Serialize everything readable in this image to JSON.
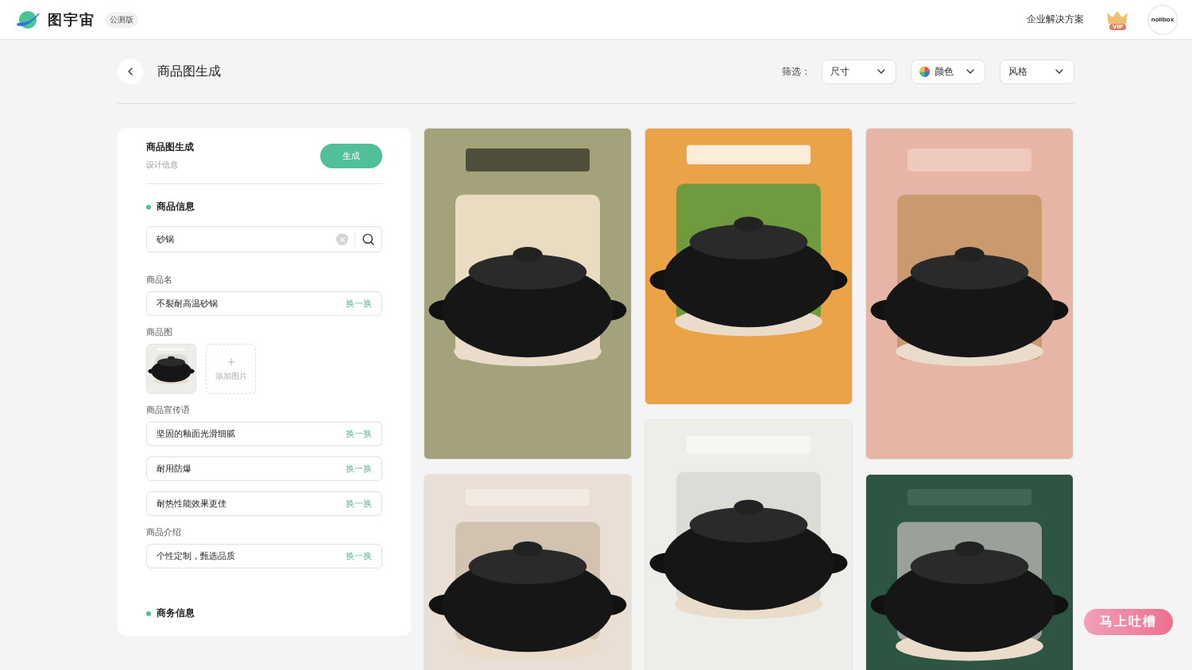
{
  "header": {
    "brand": "图宇宙",
    "badge": "公测版",
    "link": "企业解决方案",
    "vip": "VIP",
    "avatar": "nolibox"
  },
  "toolbar": {
    "title": "商品图生成",
    "filter_label": "筛选：",
    "filters": [
      {
        "label": "尺寸",
        "kind": "plain"
      },
      {
        "label": "颜色",
        "kind": "color"
      },
      {
        "label": "风格",
        "kind": "plain"
      }
    ]
  },
  "form": {
    "title": "商品图生成",
    "subtitle": "设计信息",
    "generate": "生成",
    "section": "商品信息",
    "search": "砂锅",
    "groups": [
      {
        "kind": "text",
        "label": "商品名",
        "values": [
          {
            "value": "不裂耐高温砂锅",
            "switch": "换一换"
          }
        ]
      },
      {
        "kind": "images",
        "label": "商品图",
        "add_label": "添加图片"
      },
      {
        "kind": "text",
        "label": "商品宣传语",
        "values": [
          {
            "value": "坚固的釉面光滑细腻",
            "switch": "换一换"
          },
          {
            "value": "耐用防爆",
            "switch": "换一换"
          },
          {
            "value": "耐热性能效果更佳",
            "switch": "换一换"
          }
        ]
      },
      {
        "kind": "text",
        "label": "商品介绍",
        "values": [
          {
            "value": "个性定制，甄选品质",
            "switch": "换一换"
          }
        ]
      }
    ],
    "next_section": "商务信息"
  },
  "feedback": "马上吐槽"
}
